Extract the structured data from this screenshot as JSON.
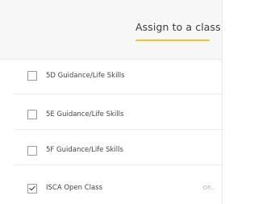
{
  "header": {
    "title": "Assign to a class",
    "accent_color": "#f2c230"
  },
  "classes": [
    {
      "label": "5D Guidance/Life Skills",
      "checked": false,
      "extra": ""
    },
    {
      "label": "5E Guidance/Life Skills",
      "checked": false,
      "extra": ""
    },
    {
      "label": "5F Guidance/Life Skills",
      "checked": false,
      "extra": ""
    },
    {
      "label": "ISCA Open Class",
      "checked": true,
      "extra": "OP..."
    }
  ]
}
